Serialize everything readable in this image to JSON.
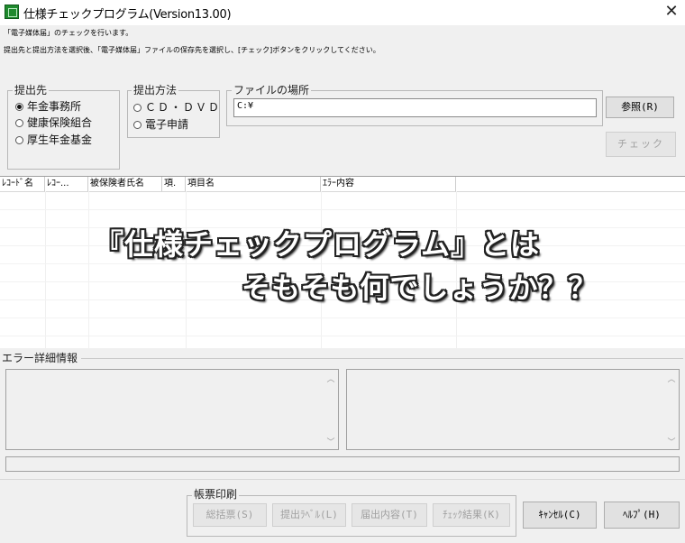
{
  "window": {
    "title": "仕様チェックプログラム(Version13.00)",
    "close_glyph": "✕"
  },
  "info": {
    "line1": "「電子媒体届」のチェックを行います。",
    "line2": "提出先と提出方法を選択後、「電子媒体届」ファイルの保存先を選択し、[チェック]ボタンをクリックしてください。"
  },
  "submit_to": {
    "label": "提出先",
    "options": [
      {
        "label": "年金事務所",
        "selected": true
      },
      {
        "label": "健康保険組合",
        "selected": false
      },
      {
        "label": "厚生年金基金",
        "selected": false
      }
    ]
  },
  "method": {
    "label": "提出方法",
    "options": [
      {
        "label": "ＣＤ・ＤＶＤ",
        "selected": false
      },
      {
        "label": "電子申請",
        "selected": false
      }
    ]
  },
  "file_location": {
    "label": "ファイルの場所",
    "value": "C:¥"
  },
  "buttons": {
    "browse": "参照(R)",
    "check": "チェック",
    "summary": "総括票(S)",
    "submit_label": "提出ﾗﾍﾞﾙ(L)",
    "submit_content": "届出内容(T)",
    "check_result": "ﾁｪｯｸ結果(K)",
    "cancel": "ｷｬﾝｾﾙ(C)",
    "help": "ﾍﾙﾌﾟ(H)"
  },
  "table": {
    "columns": [
      "ﾚｺｰﾄﾞ名",
      "ﾚｺｰ...",
      "被保険者氏名",
      "項.",
      "項目名",
      "ｴﾗｰ内容"
    ]
  },
  "overlay": {
    "line1": "『仕様チェックプログラム』とは",
    "line2": "そもそも何でしょうか？？"
  },
  "error_detail": {
    "label": "エラー詳細情報"
  },
  "print_group": {
    "label": "帳票印刷"
  }
}
